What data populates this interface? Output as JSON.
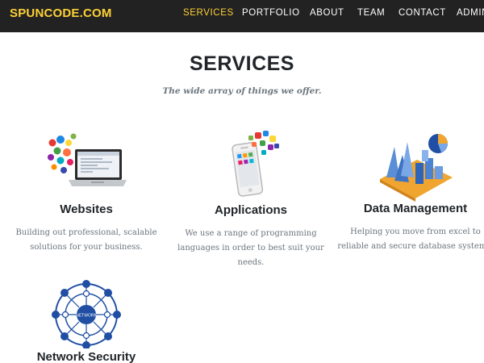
{
  "navbar": {
    "brand": "SPUNCODE.COM",
    "items": [
      {
        "label": "SERVICES",
        "active": true
      },
      {
        "label": "PORTFOLIO",
        "active": false
      },
      {
        "label": "ABOUT",
        "active": false
      },
      {
        "label": "TEAM",
        "active": false
      },
      {
        "label": "CONTACT",
        "active": false
      },
      {
        "label": "ADMIN",
        "active": false
      }
    ]
  },
  "services_section": {
    "heading": "SERVICES",
    "subheading": "The wide array of things we offer.",
    "items": [
      {
        "title": "Websites",
        "text": "Building out professional, scalable solutions for your business.",
        "icon": "laptop-icon"
      },
      {
        "title": "Applications",
        "text": "We use a range of programming languages in order to best suit your needs.",
        "icon": "smartphone-apps-icon"
      },
      {
        "title": "Data Management",
        "text": "Helping you move from excel to reliable and secure database systems.",
        "icon": "data-chart-icon"
      },
      {
        "title": "Network Security",
        "text": "",
        "icon": "network-icon"
      }
    ]
  },
  "colors": {
    "navbar_bg": "#222222",
    "accent": "#fed136",
    "heading": "#212529",
    "muted": "#6c757d",
    "icon_blue": "#1f4ea3"
  }
}
